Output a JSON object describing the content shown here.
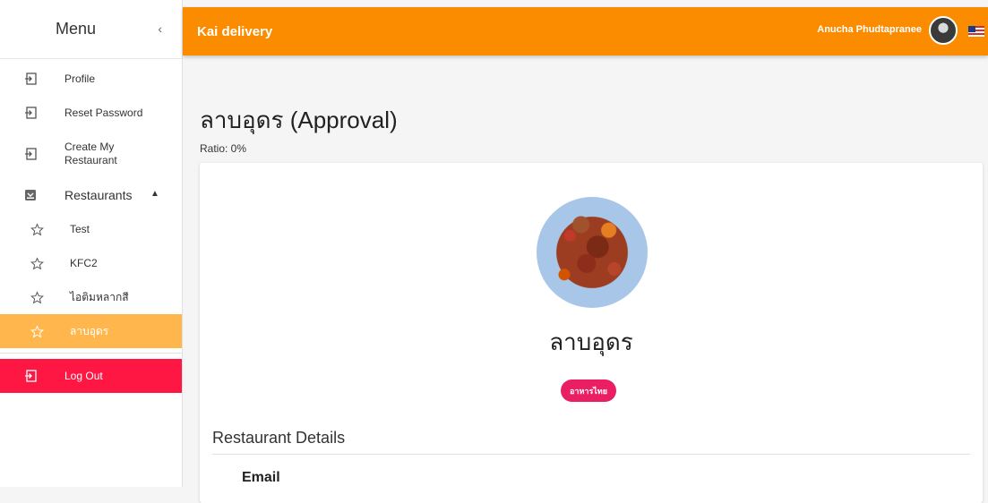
{
  "sidebar": {
    "title": "Menu",
    "collapse_icon": "chevron-left-icon",
    "items": [
      {
        "label": "Profile",
        "icon": "login-icon"
      },
      {
        "label": "Reset Password",
        "icon": "login-icon"
      },
      {
        "label": "Create My Restaurant",
        "icon": "login-icon"
      }
    ],
    "group": {
      "label": "Restaurants",
      "icon": "inbox-icon",
      "expanded": true
    },
    "restaurants": [
      {
        "label": "Test",
        "icon": "star-outline-icon"
      },
      {
        "label": "KFC2",
        "icon": "star-outline-icon"
      },
      {
        "label": "ไอติมหลากสี",
        "icon": "star-outline-icon"
      },
      {
        "label": "ลาบอุดร",
        "icon": "star-outline-icon",
        "active": true
      }
    ],
    "logout": {
      "label": "Log Out",
      "icon": "login-icon"
    }
  },
  "topbar": {
    "brand": "Kai delivery",
    "user_name": "Anucha Phudtapranee",
    "flag": "us-flag-icon"
  },
  "main": {
    "page_title": "ลาบอุดร (Approval)",
    "ratio": "Ratio: 0%",
    "restaurant_name": "ลาบอุดร",
    "category_chip": "อาหารไทย",
    "section_title": "Restaurant Details",
    "field_label": "Email"
  },
  "colors": {
    "topbar": "#fb8c00",
    "active_item": "#ffb74d",
    "logout": "#ff1744",
    "chip": "#e91e63"
  }
}
